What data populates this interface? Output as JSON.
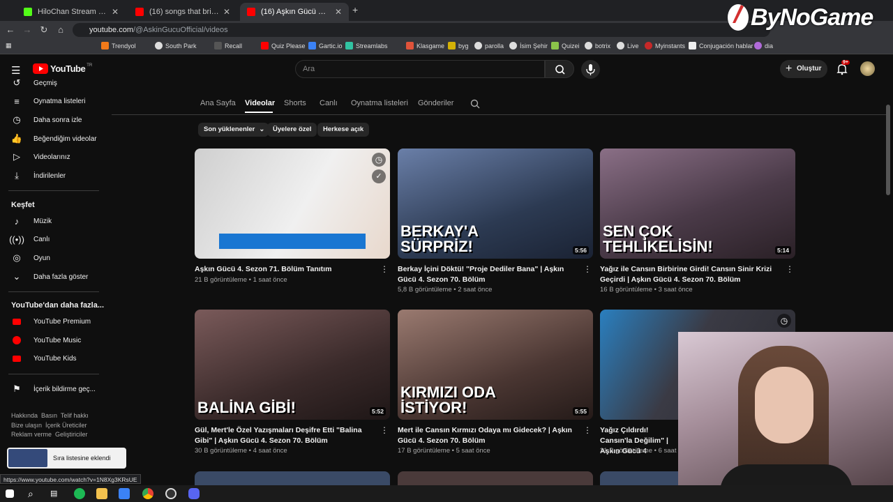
{
  "browser": {
    "tabs": [
      {
        "title": "HiloChan Stream - Watch Live o",
        "color": "#53fc18"
      },
      {
        "title": "(16) songs that bring you back",
        "color": "#ff0000"
      },
      {
        "title": "(16) Aşkın Gücü Official - YouTu",
        "color": "#ff0000"
      }
    ],
    "url_host": "youtube.com",
    "url_path": "/@AskinGucuOfficial/videos",
    "bookmarks": [
      "Trendyol",
      "South Park",
      "Recall",
      "Quiz Please",
      "Gartic.io",
      "Streamlabs",
      "Klasgame",
      "byg",
      "parolla",
      "İsim Şehir",
      "Quizei",
      "botrix",
      "Live",
      "Myinstants",
      "Conjugación hablar",
      "dia"
    ]
  },
  "overlay": {
    "logo_text": "ByNoGame"
  },
  "header": {
    "logo": "YouTube",
    "logo_sup": "TR",
    "search_placeholder": "Ara",
    "create_label": "Oluştur",
    "notif_badge": "9+"
  },
  "sidebar": {
    "items": [
      {
        "label": "Geçmiş",
        "icon": "history-icon"
      },
      {
        "label": "Oynatma listeleri",
        "icon": "playlist-icon"
      },
      {
        "label": "Daha sonra izle",
        "icon": "clock-icon"
      },
      {
        "label": "Beğendiğim videolar",
        "icon": "thumbs-up-icon"
      },
      {
        "label": "Videolarınız",
        "icon": "video-icon"
      },
      {
        "label": "İndirilenler",
        "icon": "download-icon"
      }
    ],
    "explore_title": "Keşfet",
    "explore": [
      {
        "label": "Müzik",
        "icon": "music-icon"
      },
      {
        "label": "Canlı",
        "icon": "live-icon"
      },
      {
        "label": "Oyun",
        "icon": "gaming-icon"
      },
      {
        "label": "Daha fazla göster",
        "icon": "chevron-down-icon"
      }
    ],
    "more_title": "YouTube'dan daha fazla...",
    "more": [
      {
        "label": "YouTube Premium"
      },
      {
        "label": "YouTube Music"
      },
      {
        "label": "YouTube Kids"
      }
    ],
    "report": "İçerik bildirme geç...",
    "footer1": "Hakkında  Basın  Telif hakkı",
    "footer2": "Bize ulaşın  İçerik Üreticiler",
    "footer3": "Reklam verme  Geliştiriciler"
  },
  "channel_tabs": [
    "Ana Sayfa",
    "Videolar",
    "Shorts",
    "Canlı",
    "Oynatma listeleri",
    "Gönderiler"
  ],
  "chips": [
    "Son yüklenenler",
    "Üyelere özel",
    "Herkese açık"
  ],
  "videos": [
    {
      "title": "Aşkın Gücü 4. Sezon 71. Bölüm Tanıtım",
      "meta": "21 B görüntüleme • 1 saat önce",
      "duration": "",
      "caption": "",
      "bg": "#e6e6e6"
    },
    {
      "title": "Berkay İçini Döktü! \"Proje Dediler Bana\" | Aşkın Gücü 4. Sezon 70. Bölüm",
      "meta": "5,8 B görüntüleme • 2 saat önce",
      "duration": "5:56",
      "caption": "BERKAY'A SÜRPRİZ!",
      "bg": "#3a4a66"
    },
    {
      "title": "Yağız ile Cansın Birbirine Girdi! Cansın Sinir Krizi Geçirdi | Aşkın Gücü 4. Sezon 70. Bölüm",
      "meta": "16 B görüntüleme • 3 saat önce",
      "duration": "5:14",
      "caption": "SEN ÇOK TEHLİKELİSİN!",
      "bg": "#5a4a55"
    },
    {
      "title": "Gül, Mert'le Özel Yazışmaları Deşifre Etti \"Balina Gibi\" | Aşkın Gücü 4. Sezon 70. Bölüm",
      "meta": "30 B görüntüleme • 4 saat önce",
      "duration": "5:52",
      "caption": "BALİNA GİBİ!",
      "bg": "#4a3a3a"
    },
    {
      "title": "Mert ile Cansın Kırmızı Odaya mı Gidecek? | Aşkın Gücü 4. Sezon 70. Bölüm",
      "meta": "17 B görüntüleme • 5 saat önce",
      "duration": "5:55",
      "caption": "KIRMIZI ODA İSTİYOR!",
      "bg": "#5a4642"
    },
    {
      "title": "Yağız Çıldırdı! Cansın'la Değilim\" | Aşkın Gücü 4",
      "meta": "31 B görüntüleme • 6 saat ö",
      "duration": "",
      "caption": "",
      "bg": "#3a3a44"
    }
  ],
  "toast": "Sıra listesine eklendi",
  "status_url": "https://www.youtube.com/watch?v=1N8Xg3KRsUE"
}
